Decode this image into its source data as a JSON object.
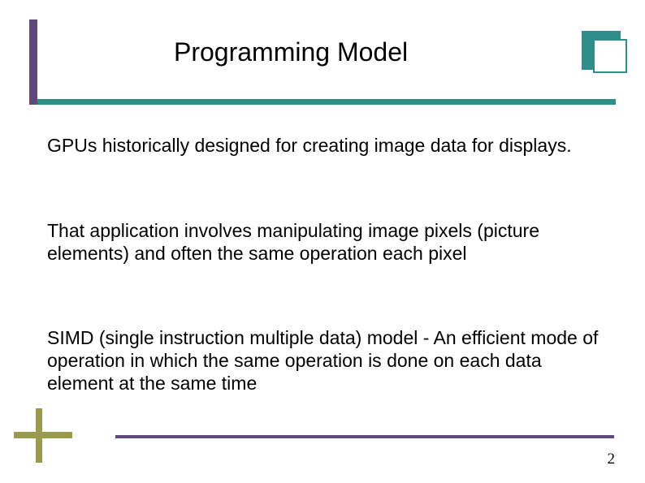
{
  "title": "Programming Model",
  "paragraphs": {
    "p1": "GPUs historically designed for creating image data for displays.",
    "p2": "That application involves manipulating image pixels (picture elements) and often the same operation each pixel",
    "p3": "SIMD (single instruction multiple data) model - An efficient mode of operation in which the same operation is done on each data element at the same time"
  },
  "page_number": "2"
}
